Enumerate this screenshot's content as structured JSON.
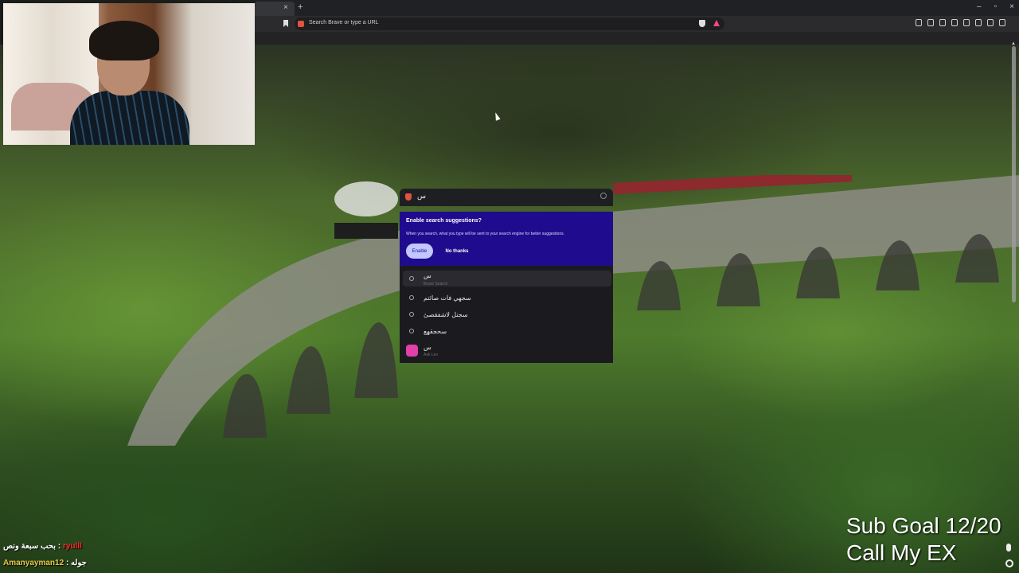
{
  "browser": {
    "tab_close": "×",
    "tab_new": "+",
    "window_buttons": [
      "–",
      "▫",
      "×"
    ],
    "url_placeholder": "Search Brave or type a URL"
  },
  "omnibox": {
    "query": "س",
    "suggestion_prompt": {
      "title": "Enable search suggestions?",
      "description": "When you search, what you type will be sent to your search engine for better suggestions.",
      "enable_label": "Enable",
      "decline_label": "No thanks"
    },
    "results": [
      {
        "text": "س",
        "sub": "Brave Search"
      },
      {
        "text": "سجهي فات صائتم",
        "sub": ""
      },
      {
        "text": "سجنل لاشفقصئ",
        "sub": ""
      },
      {
        "text": "سحجقهع",
        "sub": ""
      },
      {
        "text": "س",
        "sub": "Ask Leo"
      }
    ]
  },
  "overlay": {
    "sub_goal_line1": "Sub Goal 12/20",
    "sub_goal_line2": "Call My EX",
    "chat": [
      {
        "user": "ryulll",
        "message": "بحب سبعة ونص :"
      },
      {
        "user": "Amanyayman12",
        "message": ": جوله"
      }
    ]
  },
  "colors": {
    "suggestion_banner": "#1f0b8e",
    "enable_button": "#c2c7ff",
    "brave_accent": "#e0533d",
    "chat_user1": "#ff2a2a",
    "chat_user2": "#e8c84a"
  }
}
